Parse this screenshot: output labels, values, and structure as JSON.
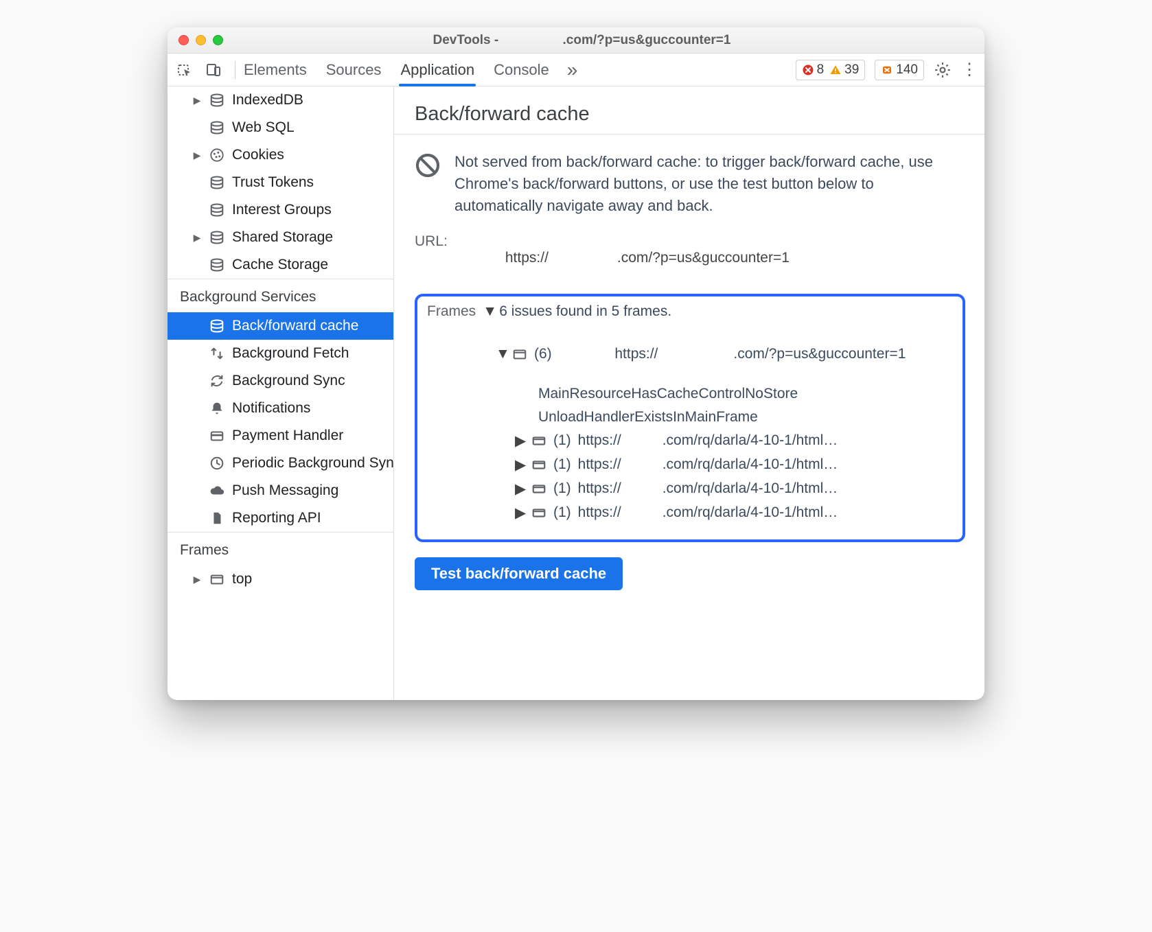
{
  "window": {
    "title_prefix": "DevTools - ",
    "title_suffix": ".com/?p=us&guccounter=1"
  },
  "toolbar": {
    "tabs": [
      "Elements",
      "Sources",
      "Application",
      "Console"
    ],
    "active_tab_index": 2,
    "errors_count": "8",
    "warnings_count": "39",
    "issues_count": "140"
  },
  "sidebar": {
    "storage_items": [
      {
        "label": "IndexedDB",
        "icon": "db",
        "expandable": true
      },
      {
        "label": "Web SQL",
        "icon": "db",
        "expandable": false
      },
      {
        "label": "Cookies",
        "icon": "cookie",
        "expandable": true
      },
      {
        "label": "Trust Tokens",
        "icon": "db",
        "expandable": false
      },
      {
        "label": "Interest Groups",
        "icon": "db",
        "expandable": false
      },
      {
        "label": "Shared Storage",
        "icon": "db",
        "expandable": true
      },
      {
        "label": "Cache Storage",
        "icon": "db",
        "expandable": false
      }
    ],
    "bg_title": "Background Services",
    "bg_items": [
      {
        "label": "Back/forward cache",
        "icon": "db",
        "selected": true
      },
      {
        "label": "Background Fetch",
        "icon": "fetch"
      },
      {
        "label": "Background Sync",
        "icon": "sync"
      },
      {
        "label": "Notifications",
        "icon": "bell"
      },
      {
        "label": "Payment Handler",
        "icon": "card"
      },
      {
        "label": "Periodic Background Sync",
        "icon": "clock"
      },
      {
        "label": "Push Messaging",
        "icon": "cloud"
      },
      {
        "label": "Reporting API",
        "icon": "file"
      }
    ],
    "frames_title": "Frames",
    "frames_items": [
      {
        "label": "top",
        "icon": "frame",
        "expandable": true
      }
    ]
  },
  "content": {
    "title": "Back/forward cache",
    "info": "Not served from back/forward cache: to trigger back/forward cache, use Chrome's back/forward buttons, or use the test button below to automatically navigate away and back.",
    "url_label": "URL:",
    "url_value_prefix": "https://",
    "url_value_suffix": ".com/?p=us&guccounter=1",
    "frames_label": "Frames",
    "frames_summary": "6 issues found in 5 frames.",
    "root_frame_count": "(6)",
    "root_frame_url_prefix": "https://",
    "root_frame_url_suffix": ".com/?p=us&guccounter=1",
    "reasons": [
      "MainResourceHasCacheControlNoStore",
      "UnloadHandlerExistsInMainFrame"
    ],
    "sub_count": "(1)",
    "sub_url_prefix": "https://",
    "sub_url_suffix": ".com/rq/darla/4-10-1/html",
    "button_label": "Test back/forward cache"
  }
}
